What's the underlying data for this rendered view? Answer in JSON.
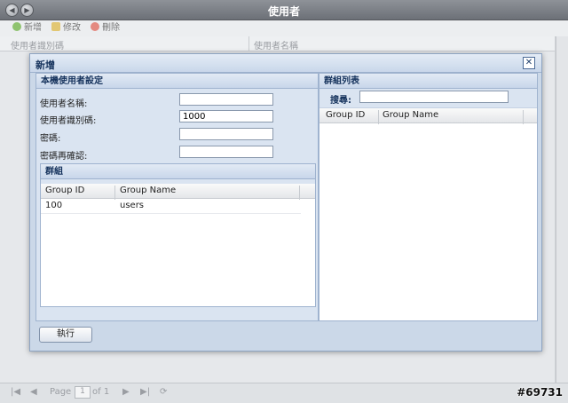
{
  "window": {
    "title": "使用者"
  },
  "toolbar": {
    "add_label": "新增",
    "edit_label": "修改",
    "delete_label": "刪除"
  },
  "background_grid": {
    "col1": "使用者識別碼",
    "col2": "使用者名稱"
  },
  "pager": {
    "page_label": "Page",
    "page_value": "1",
    "of_label": "of 1"
  },
  "watermark": "#69731",
  "dialog": {
    "title": "新增",
    "local_settings": {
      "header": "本機使用者設定",
      "username_label": "使用者名稱:",
      "username_value": "",
      "uid_label": "使用者識別碼:",
      "uid_value": "1000",
      "password_label": "密碼:",
      "password_value": "",
      "confirm_label": "密碼再確認:",
      "confirm_value": ""
    },
    "groups": {
      "header": "群組",
      "columns": [
        "Group ID",
        "Group Name"
      ],
      "rows": [
        {
          "id": "100",
          "name": "users"
        }
      ]
    },
    "group_list": {
      "header": "群組列表",
      "search_label": "搜尋:",
      "search_value": "",
      "columns": [
        "Group ID",
        "Group Name"
      ]
    },
    "execute_label": "執行"
  },
  "colors": {
    "dialog_bg": "#cbd8e8",
    "header_text": "#15325c",
    "titlebar": "#7d8188"
  }
}
